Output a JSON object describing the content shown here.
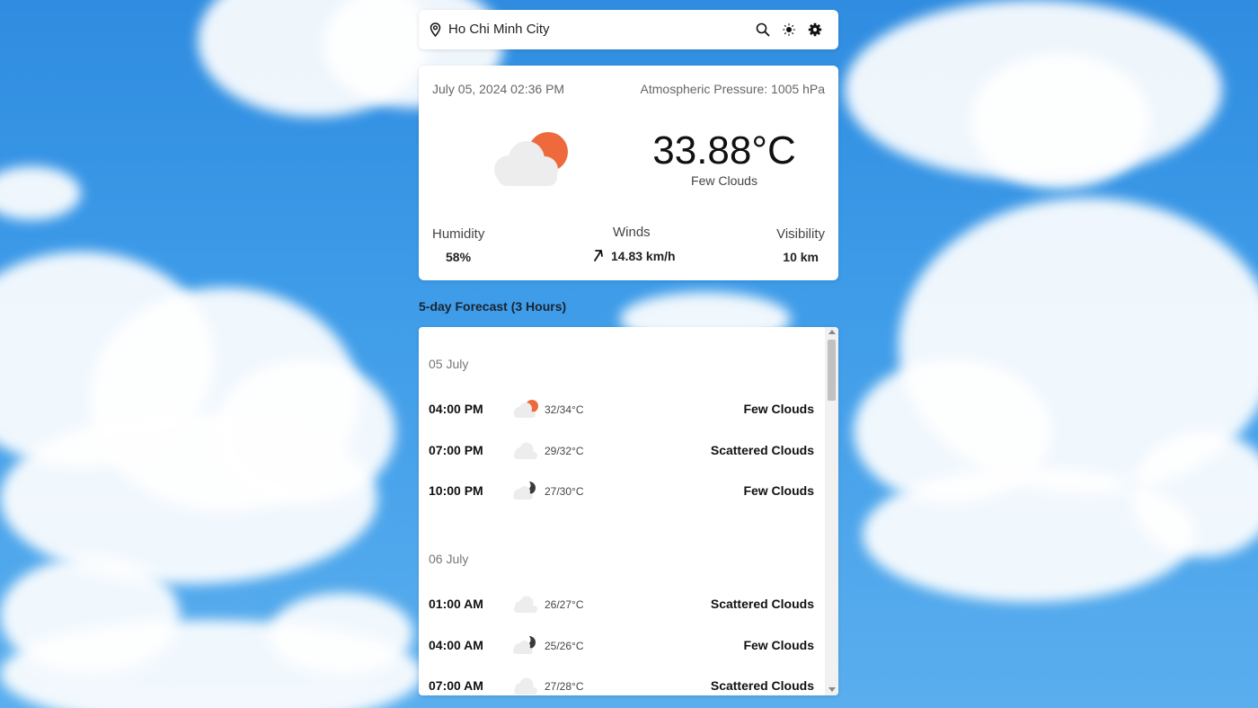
{
  "colors": {
    "accent": "#ee6a3c",
    "cloud": "#eeeeee",
    "moon": "#3a3a3a"
  },
  "search": {
    "city": "Ho Chi Minh City",
    "icons": [
      "location-icon",
      "search-icon",
      "theme-toggle-icon",
      "settings-icon"
    ]
  },
  "current": {
    "date": "July 05, 2024 02:36 PM",
    "pressure": "Atmospheric Pressure: 1005 hPa",
    "temperature": "33.88°C",
    "description": "Few Clouds",
    "icon": "few-clouds-day-icon",
    "humidity_label": "Humidity",
    "humidity_value": "58%",
    "winds_label": "Winds",
    "winds_value": "14.83 km/h",
    "visibility_label": "Visibility",
    "visibility_value": "10 km"
  },
  "forecast": {
    "title": "5-day Forecast (3 Hours)",
    "days": [
      {
        "label": "05 July",
        "rows": [
          {
            "time": "04:00 PM",
            "range": "32/34°C",
            "condition": "Few Clouds",
            "icon": "few-clouds-day-icon"
          },
          {
            "time": "07:00 PM",
            "range": "29/32°C",
            "condition": "Scattered Clouds",
            "icon": "scattered-clouds-icon"
          },
          {
            "time": "10:00 PM",
            "range": "27/30°C",
            "condition": "Few Clouds",
            "icon": "few-clouds-night-icon"
          }
        ]
      },
      {
        "label": "06 July",
        "rows": [
          {
            "time": "01:00 AM",
            "range": "26/27°C",
            "condition": "Scattered Clouds",
            "icon": "scattered-clouds-icon"
          },
          {
            "time": "04:00 AM",
            "range": "25/26°C",
            "condition": "Few Clouds",
            "icon": "few-clouds-night-icon"
          },
          {
            "time": "07:00 AM",
            "range": "27/28°C",
            "condition": "Scattered Clouds",
            "icon": "scattered-clouds-icon"
          }
        ]
      }
    ]
  }
}
